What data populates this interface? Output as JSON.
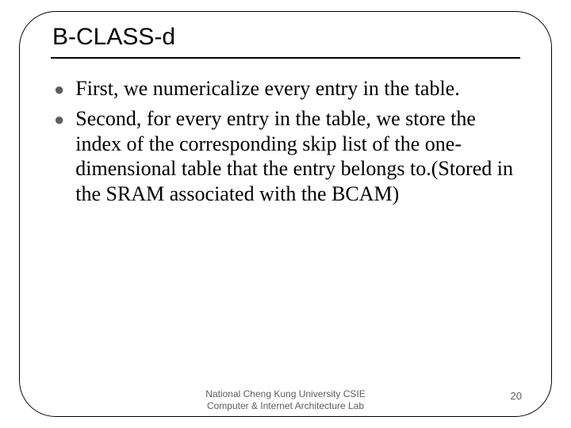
{
  "slide": {
    "title": "B-CLASS-d",
    "bullets": [
      "First, we numericalize every entry in the table.",
      "Second, for every entry in the table, we store the index of the corresponding skip list of the one-dimensional table that the entry belongs to.(Stored in the SRAM associated with the BCAM)"
    ],
    "footer": {
      "org_line1": "National Cheng Kung University CSIE",
      "org_line2": "Computer & Internet Architecture Lab",
      "page_number": "20"
    }
  }
}
